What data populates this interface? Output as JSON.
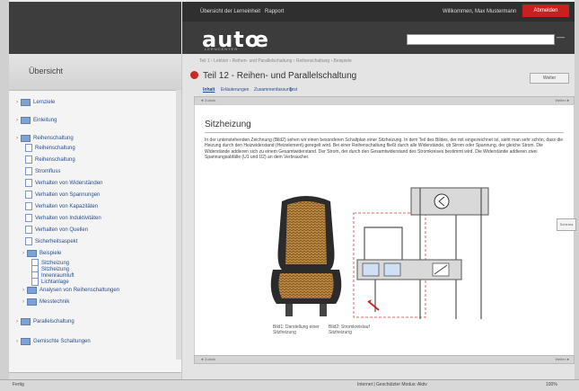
{
  "left_panel": {
    "header": "Übersicht",
    "tree": [
      {
        "label": "Lernziele",
        "kind": "folder",
        "level": 0
      },
      {
        "label": "Einleitung",
        "kind": "folder",
        "level": 0
      },
      {
        "label": "Reihenschaltung",
        "kind": "folder",
        "level": 0
      },
      {
        "label": "Reihenschaltung",
        "kind": "page",
        "level": 1
      },
      {
        "label": "Reihenschaltung",
        "kind": "page",
        "level": 1
      },
      {
        "label": "Stromfluss",
        "kind": "page",
        "level": 1
      },
      {
        "label": "Verhalten von Widerständen",
        "kind": "page",
        "level": 1
      },
      {
        "label": "Verhalten von Spannungen",
        "kind": "page",
        "level": 1
      },
      {
        "label": "Verhalten von Kapazitäten",
        "kind": "page",
        "level": 1
      },
      {
        "label": "Verhalten von Induktivitäten",
        "kind": "page",
        "level": 1
      },
      {
        "label": "Verhalten von Quellen",
        "kind": "page",
        "level": 1
      },
      {
        "label": "Sicherheitsaspekt",
        "kind": "page",
        "level": 1
      },
      {
        "label": "Beispiele",
        "kind": "folder",
        "level": 1
      },
      {
        "label": "Sitzheizung",
        "kind": "page",
        "level": 2
      },
      {
        "label": "Sitzheizung",
        "kind": "page",
        "level": 2
      },
      {
        "label": "Innenraumluft",
        "kind": "page",
        "level": 2
      },
      {
        "label": "Lichtanlage",
        "kind": "page",
        "level": 2
      },
      {
        "label": "Analysen von Reihenschaltungen",
        "kind": "folder",
        "level": 1
      },
      {
        "label": "Messtechnik",
        "kind": "folder",
        "level": 1
      },
      {
        "label": "Parallelschaltung",
        "kind": "folder",
        "level": 0
      },
      {
        "label": "Gemischte Schaltungen",
        "kind": "folder",
        "level": 0
      }
    ]
  },
  "topbar": {
    "menu1": "Übersicht der Lerneinheit",
    "menu2": "Rapport",
    "user": "Willkommen, Max Mustermann",
    "logout": "Abmelden"
  },
  "brand": {
    "logo": "autœ",
    "sub": "LERNCENTER"
  },
  "page": {
    "breadcrumb": "Teil 1 › Lektion › Reihen- und Parallelschaltung › Reihenschaltung › Beispiele",
    "title": "Teil 12 - Reihen- und Parallelschaltung",
    "title_button": "Weiter",
    "tabs": [
      "Inhalt",
      "Erläuterungen",
      "Zusammenfassung",
      "Test"
    ],
    "content_header_left": "◄ Zurück",
    "content_header_right": "Weiter ►",
    "heading": "Sitzheizung",
    "paragraph": "In der untenstehenden Zeichnung (Bild2) sehen wir einen besonderen Schaltplan einer Sitzheizung. In dem Teil des Bildes, der mit eingezeichnet ist, sieht man sehr schön, dass die Heizung durch den Heizwiderstand (Heizelement) geregelt wird. Bei einer Reihenschaltung fließt durch alle Widerstände, ob Strom oder Spannung, der gleiche Strom. Die Widerstände addieren sich zu einem Gesamtwiderstand. Der Strom, der durch den Gesamtwiderstand des Stromkreises bestimmt wird. Die Widerstände addieren zwei Spannungsabfälle (U1 und U2) an dem Verbraucher.",
    "caption1": "Bild1: Darstellung einer Sitzheizung",
    "caption2": "Bild2: Stromkreislauf Sitzheizung",
    "side_tab": "Schema",
    "content_footer_left": "◄ Zurück",
    "content_footer_right": "Weiter ►"
  },
  "status": {
    "left": "Fertig",
    "middle": "Internet | Geschützter Modus: Aktiv",
    "right": "100%"
  }
}
